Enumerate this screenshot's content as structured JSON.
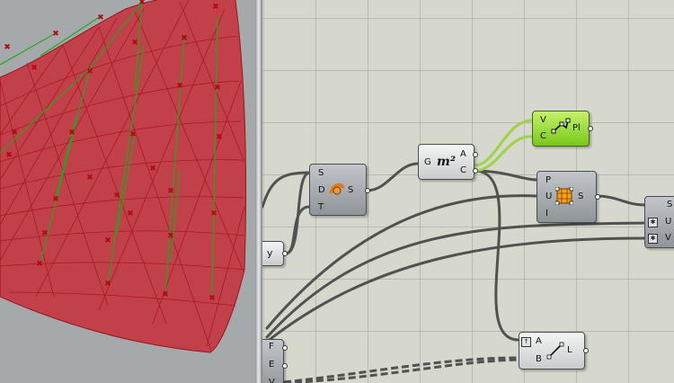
{
  "viewport": {
    "mesh_color": "#b3121c",
    "fill_color": "#c2404a",
    "green_edge": "#21a81f",
    "background": "#a6a9ab"
  },
  "canvas": {
    "background": "#d6d8cd",
    "wire_color": "#4f5251",
    "active_wire_color": "#9fd24a"
  },
  "nodes": {
    "area": {
      "input": "G",
      "icon": "m²",
      "outputs": [
        "A",
        "C"
      ]
    },
    "point": {
      "inputs": [
        "S",
        "D",
        "T"
      ],
      "output": "S"
    },
    "plane": {
      "inputs": [
        "V",
        "C"
      ],
      "output": "Pl"
    },
    "surface_points": {
      "inputs": [
        "P",
        "U",
        "I"
      ],
      "output": "S"
    },
    "right_partial": {
      "ports": [
        "S",
        "U",
        "V"
      ]
    },
    "line": {
      "inputs": [
        "A",
        "B"
      ],
      "output": "L"
    },
    "y_param": {
      "label": "y"
    },
    "fev": {
      "ports": [
        "F",
        "E",
        "V"
      ]
    }
  }
}
